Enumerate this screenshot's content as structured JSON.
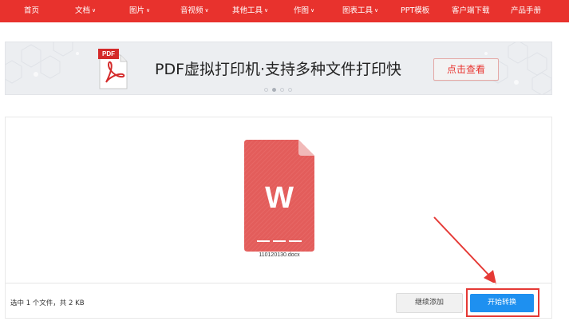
{
  "nav": {
    "items": [
      {
        "label": "首页",
        "has_dropdown": false
      },
      {
        "label": "文档",
        "has_dropdown": true
      },
      {
        "label": "图片",
        "has_dropdown": true
      },
      {
        "label": "音视频",
        "has_dropdown": true
      },
      {
        "label": "其他工具",
        "has_dropdown": true
      },
      {
        "label": "作图",
        "has_dropdown": true
      },
      {
        "label": "图表工具",
        "has_dropdown": true
      },
      {
        "label": "PPT模板",
        "has_dropdown": false
      },
      {
        "label": "客户端下载",
        "has_dropdown": false
      },
      {
        "label": "产品手册",
        "has_dropdown": false
      }
    ],
    "chevron_icon": "chevron-down-icon",
    "background_color": "#e8322d"
  },
  "banner": {
    "badge_text": "PDF",
    "title": "PDF虚拟打印机·支持多种文件打印快",
    "button_label": "点击查看",
    "carousel_dots": 4,
    "active_dot": 2
  },
  "upload": {
    "file": {
      "name": "110120130.docx",
      "type_letter": "W",
      "icon": "word-file-icon",
      "color": "#e35d5b"
    },
    "status_text": "选中 1 个文件，共 2 KB",
    "continue_label": "继续添加",
    "start_label": "开始转换",
    "start_color": "#1e90f0",
    "annotation_color": "#e53935"
  }
}
